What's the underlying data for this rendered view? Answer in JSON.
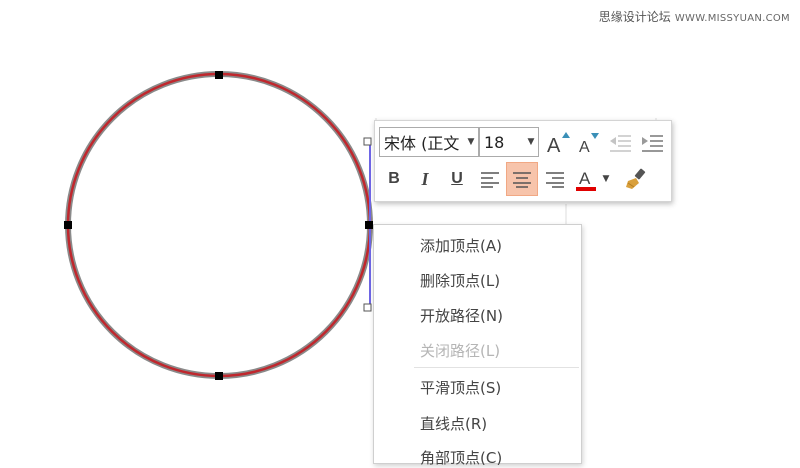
{
  "watermark": {
    "site": "思缘设计论坛",
    "url": "WWW.MISSYUAN.COM"
  },
  "toolbar": {
    "font_name": "宋体 (正文",
    "font_size": "18",
    "grow_font_label": "A",
    "shrink_font_label": "A",
    "bold_label": "B",
    "italic_label": "I",
    "underline_label": "U",
    "font_color_label": "A",
    "font_color": "#e00000",
    "active_button": "align-center"
  },
  "menu": {
    "items": [
      {
        "label": "添加顶点(A)",
        "enabled": true
      },
      {
        "label": "删除顶点(L)",
        "enabled": true
      },
      {
        "label": "开放路径(N)",
        "enabled": true
      },
      {
        "label": "关闭路径(L)",
        "enabled": false
      },
      {
        "label": "平滑顶点(S)",
        "enabled": true
      },
      {
        "label": "直线点(R)",
        "enabled": true
      },
      {
        "label": "角部顶点(C)",
        "enabled": true
      }
    ]
  },
  "colors": {
    "circle_outer": "#8a8a8a",
    "circle_inner": "#c0272d",
    "selection_edge": "#6f66e6",
    "active_highlight": "#f7c4ab"
  }
}
